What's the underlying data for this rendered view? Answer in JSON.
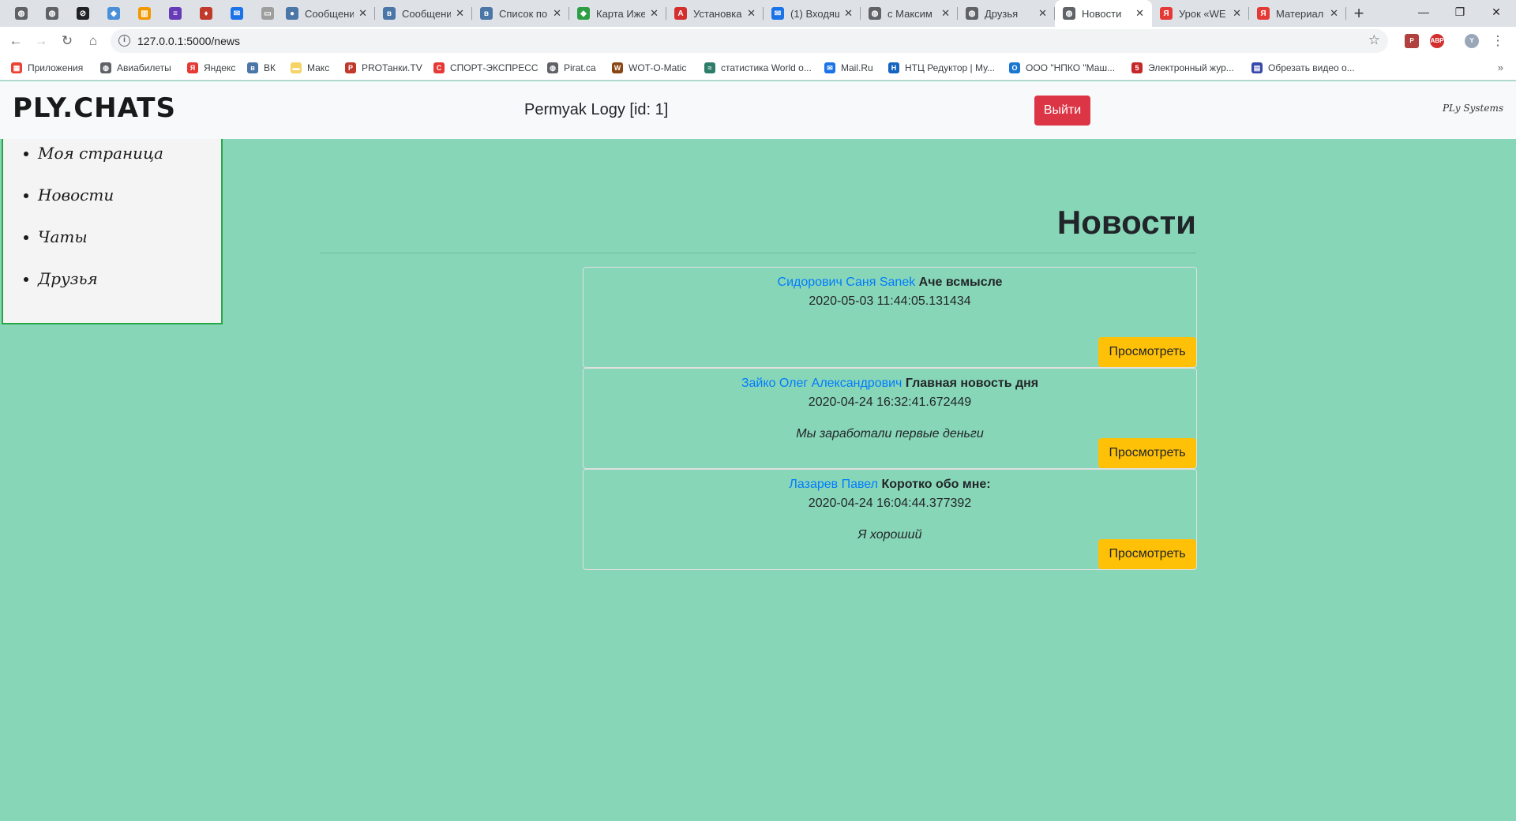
{
  "browser": {
    "pinned_tabs": [
      {
        "icon": "globe-icon",
        "color": "#5f6368"
      },
      {
        "icon": "globe-icon",
        "color": "#5f6368"
      },
      {
        "icon": "circle-slash-icon",
        "color": "#202124"
      },
      {
        "icon": "cube-icon",
        "color": "#4a90d9"
      },
      {
        "icon": "bar-chart-icon",
        "color": "#f29900"
      },
      {
        "icon": "list-icon",
        "color": "#673ab7"
      },
      {
        "icon": "game-icon",
        "color": "#c0392b"
      },
      {
        "icon": "mail-icon",
        "color": "#1a73e8"
      },
      {
        "icon": "doc-icon",
        "color": "#9e9e9e"
      }
    ],
    "tabs": [
      {
        "title": "Сообщени",
        "icon": "chat-icon",
        "color": "#4a76a8",
        "active": false
      },
      {
        "title": "Сообщени",
        "icon": "vk-icon",
        "color": "#4a76a8",
        "active": false
      },
      {
        "title": "Список по",
        "icon": "vk-icon",
        "color": "#4a76a8",
        "active": false
      },
      {
        "title": "Карта Иже",
        "icon": "map-icon",
        "color": "#2e9e44",
        "active": false
      },
      {
        "title": "Установка",
        "icon": "abp-icon",
        "color": "#d32f2f",
        "active": false
      },
      {
        "title": "(1) Входящ",
        "icon": "mail-icon",
        "color": "#1a73e8",
        "active": false
      },
      {
        "title": "с Максим",
        "icon": "globe-icon",
        "color": "#5f6368",
        "active": false
      },
      {
        "title": "Друзья",
        "icon": "globe-icon",
        "color": "#5f6368",
        "active": false
      },
      {
        "title": "Новости",
        "icon": "globe-icon",
        "color": "#5f6368",
        "active": true
      },
      {
        "title": "Урок «WE",
        "icon": "yandex-icon",
        "color": "#e53935",
        "active": false
      },
      {
        "title": "Материал",
        "icon": "yandex-icon",
        "color": "#e53935",
        "active": false
      }
    ],
    "new_tab_label": "+",
    "url": "127.0.0.1:5000/news",
    "bookmarks": [
      {
        "label": "Приложения",
        "icon": "apps-icon",
        "color": "#ea4335"
      },
      {
        "label": "Авиабилеты",
        "icon": "globe-icon",
        "color": "#5f6368"
      },
      {
        "label": "Яндекс",
        "icon": "yandex-icon",
        "color": "#e53935"
      },
      {
        "label": "ВК",
        "icon": "vk-icon",
        "color": "#4a76a8"
      },
      {
        "label": "Макс",
        "icon": "folder-icon",
        "color": "#f6d365"
      },
      {
        "label": "PROТанки.TV",
        "icon": "tank-icon",
        "color": "#c0392b"
      },
      {
        "label": "СПОРТ-ЭКСПРЕСС",
        "icon": "sport-icon",
        "color": "#e53935"
      },
      {
        "label": "Pirat.ca",
        "icon": "globe-icon",
        "color": "#5f6368"
      },
      {
        "label": "WOT-O-Matic",
        "icon": "wot-icon",
        "color": "#8b4513"
      },
      {
        "label": "статистика World o...",
        "icon": "stats-icon",
        "color": "#2e7d6b"
      },
      {
        "label": "Mail.Ru",
        "icon": "mail-icon",
        "color": "#1a73e8"
      },
      {
        "label": "НТЦ Редуктор | Му...",
        "icon": "ntc-icon",
        "color": "#1565c0"
      },
      {
        "label": "ООО \"НПКО \"Маш...",
        "icon": "npko-icon",
        "color": "#1976d2"
      },
      {
        "label": "Электронный жур...",
        "icon": "journal-icon",
        "color": "#c62828"
      },
      {
        "label": "Обрезать видео о...",
        "icon": "video-icon",
        "color": "#3949ab"
      }
    ]
  },
  "header": {
    "logo": "PLY.CHATS",
    "user": "Permyak Logy [id: 1]",
    "logout_label": "Выйти",
    "brand": "PLy Systems"
  },
  "sidebar": {
    "items": [
      "Моя страница",
      "Новости",
      "Чаты",
      "Друзья"
    ]
  },
  "main": {
    "title": "Новости",
    "view_label": "Просмотреть",
    "news": [
      {
        "author": "Сидорович Саня Sanek",
        "title": "Аче всмысле",
        "date": "2020-05-03 11:44:05.131434",
        "body": ""
      },
      {
        "author": "Зайко Олег Александрович",
        "title": "Главная новость дня",
        "date": "2020-04-24 16:32:41.672449",
        "body": "Мы заработали первые деньги"
      },
      {
        "author": "Лазарев Павел",
        "title": "Коротко обо мне:",
        "date": "2020-04-24 16:04:44.377392",
        "body": "Я хороший"
      }
    ]
  },
  "colors": {
    "page_background": "#88d6b8",
    "logout": "#dc3545",
    "view_button": "#ffc107",
    "author_link": "#007bff",
    "sidebar_border": "#28a745"
  }
}
